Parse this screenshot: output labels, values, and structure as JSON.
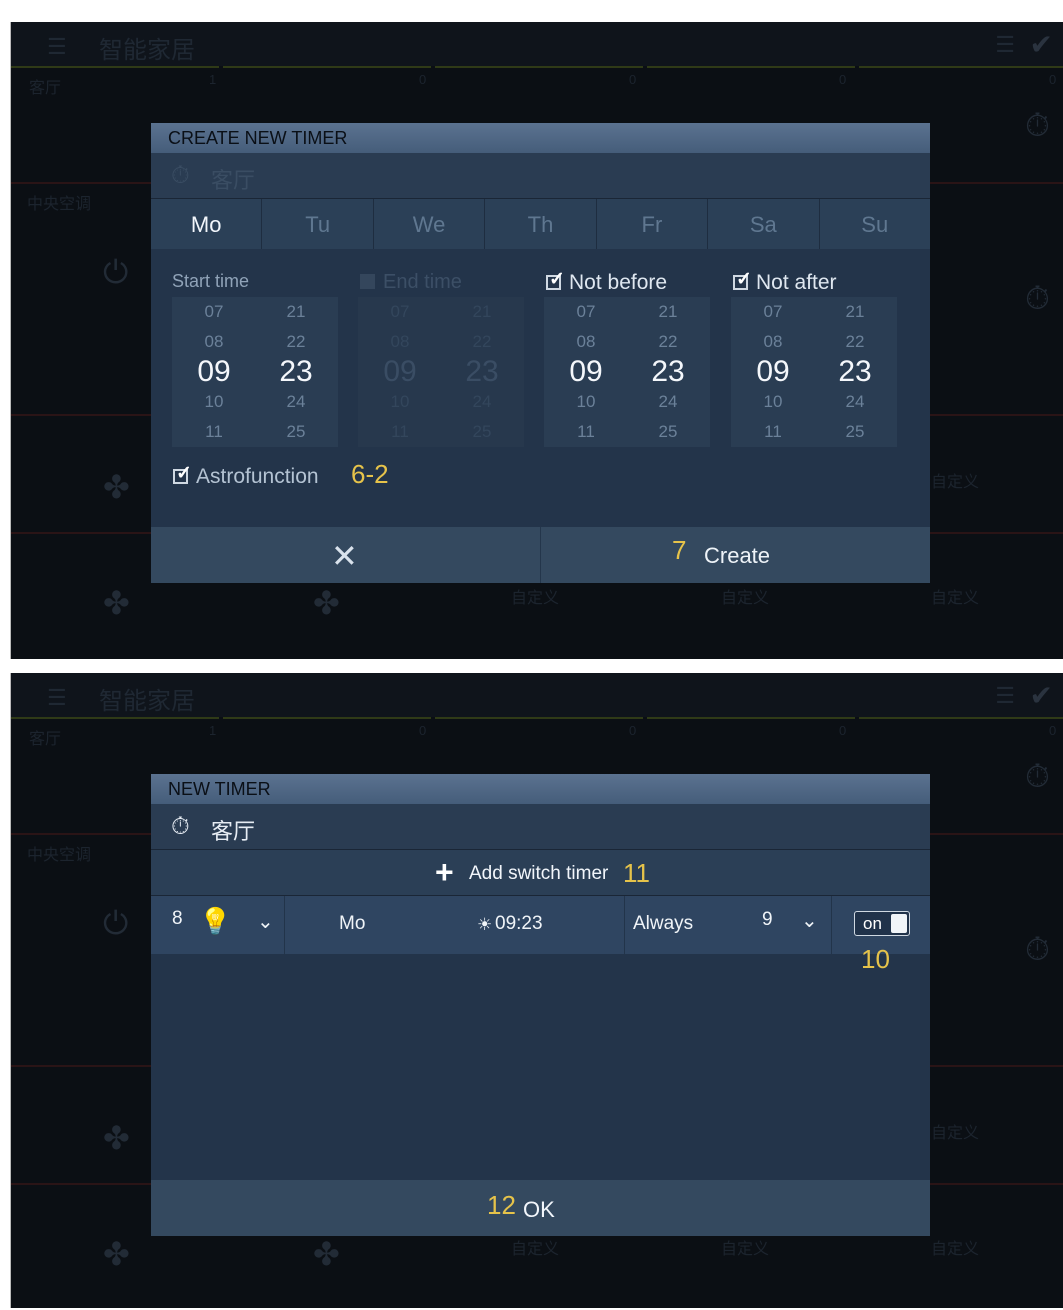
{
  "background": {
    "app_title": "智能家居",
    "room_main": "客厅",
    "room_ac": "中央空调",
    "custom_label": "自定义",
    "tile_counts": [
      "1",
      "0",
      "0",
      "0",
      "0"
    ]
  },
  "create_dialog": {
    "title": "CREATE NEW TIMER",
    "room": "客厅",
    "days": [
      "Mo",
      "Tu",
      "We",
      "Th",
      "Fr",
      "Sa",
      "Su"
    ],
    "active_day": "Mo",
    "pickers": [
      {
        "label": "Start time",
        "checkable": false,
        "checked": true,
        "enabled": true,
        "hours": [
          "07",
          "08",
          "09",
          "10",
          "11"
        ],
        "minutes": [
          "21",
          "22",
          "23",
          "24",
          "25"
        ]
      },
      {
        "label": "End time",
        "checkable": true,
        "checked": false,
        "enabled": false,
        "hours": [
          "07",
          "08",
          "09",
          "10",
          "11"
        ],
        "minutes": [
          "21",
          "22",
          "23",
          "24",
          "25"
        ]
      },
      {
        "label": "Not before",
        "checkable": true,
        "checked": true,
        "enabled": true,
        "hours": [
          "07",
          "08",
          "09",
          "10",
          "11"
        ],
        "minutes": [
          "21",
          "22",
          "23",
          "24",
          "25"
        ]
      },
      {
        "label": "Not after",
        "checkable": true,
        "checked": true,
        "enabled": true,
        "hours": [
          "07",
          "08",
          "09",
          "10",
          "11"
        ],
        "minutes": [
          "21",
          "22",
          "23",
          "24",
          "25"
        ]
      }
    ],
    "astrofunction_label": "Astrofunction",
    "astrofunction_checked": true,
    "astrofunction_annotation": "6-2",
    "cancel_icon": "close-icon",
    "create_label": "Create",
    "create_annotation": "7"
  },
  "new_timer_dialog": {
    "title": "NEW TIMER",
    "room": "客厅",
    "add_label": "Add switch timer",
    "add_annotation": "11",
    "timer": {
      "device_annotation": "8",
      "device_icon": "light-bulb-icon",
      "day": "Mo",
      "time": "09:23",
      "time_icon": "sunrise-icon",
      "mode": "Always",
      "mode_annotation": "9",
      "switch_label": "on",
      "switch_on": true,
      "switch_annotation": "10"
    },
    "ok_annotation": "12",
    "ok_label": "OK"
  }
}
